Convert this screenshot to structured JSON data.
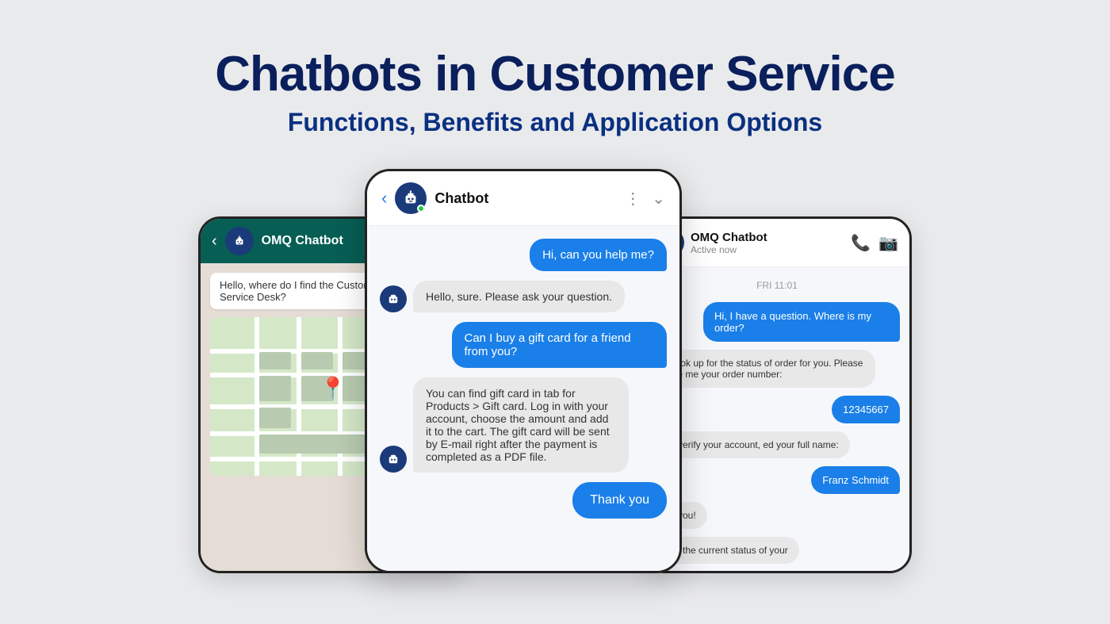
{
  "header": {
    "main_title": "Chatbots in Customer Service",
    "sub_title": "Functions, Benefits and Application Options"
  },
  "left_phone": {
    "bot_name": "OMQ Chatbot",
    "chat_bubble": "Hello, where do I find the Customer Service Desk?"
  },
  "center_phone": {
    "bot_name": "Chatbot",
    "messages": [
      {
        "type": "sent",
        "text": "Hi, can you help me?"
      },
      {
        "type": "received",
        "text": "Hello, sure. Please ask your question."
      },
      {
        "type": "sent",
        "text": "Can I buy a gift card for a friend from you?"
      },
      {
        "type": "received",
        "text": "You can find gift card in tab for Products > Gift card. Log in with your account, choose the amount and add it to the cart. The gift card will be sent by E-mail right after the payment is completed as a PDF file."
      },
      {
        "type": "sent_btn",
        "text": "Thank you"
      }
    ]
  },
  "right_phone": {
    "bot_name": "OMQ Chatbot",
    "status": "Active now",
    "date_label": "FRI 11:01",
    "messages": [
      {
        "type": "sent",
        "text": "Hi, I have a question. Where is my order?"
      },
      {
        "type": "received",
        "text": "n look up for the status of order for you. Please vide me your order number:"
      },
      {
        "type": "sent",
        "text": "12345667"
      },
      {
        "type": "received",
        "text": "To verify your account, ed your full name:"
      },
      {
        "type": "sent",
        "text": "Franz Schmidt"
      },
      {
        "type": "received",
        "text": "nk you!"
      },
      {
        "type": "received2",
        "text": "e is the current status of your"
      }
    ]
  }
}
